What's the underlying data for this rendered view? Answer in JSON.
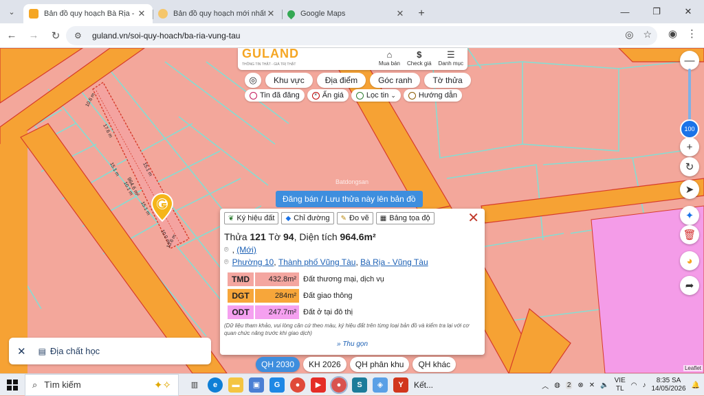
{
  "browser": {
    "tabs": [
      {
        "title": "Bản đồ quy hoạch Bà Rịa - Vũng",
        "active": true,
        "favicon_color": "#f5a623"
      },
      {
        "title": "Bản đồ quy hoạch mới nhất Th",
        "active": false,
        "favicon_color": "#f5a623"
      },
      {
        "title": "Google Maps",
        "active": false,
        "favicon_color": "#34a853"
      }
    ],
    "url": "guland.vn/soi-quy-hoach/ba-ria-vung-tau"
  },
  "header": {
    "logo": "GULAND",
    "tagline": "THÔNG TIN THẬT - GIÁ TRỊ THẬT",
    "nav": [
      {
        "label": "Mua bán",
        "icon": "house-icon"
      },
      {
        "label": "Check giá",
        "icon": "dollar-icon"
      },
      {
        "label": "Danh mục",
        "icon": "menu-icon"
      }
    ]
  },
  "chips": {
    "row1": [
      "Khu vực",
      "Địa điểm",
      "Góc ranh",
      "Tờ thửa"
    ],
    "row2": [
      "Tin đã đăng",
      "Ẩn giá",
      "Lọc tin",
      "Hướng dẫn"
    ]
  },
  "zoom": {
    "value": "100"
  },
  "share_button": "Đăng bán / Lưu thửa này lên bản đồ",
  "popup": {
    "tools": [
      "Ký hiệu đất",
      "Chỉ đường",
      "Đo vẽ",
      "Bảng tọa độ"
    ],
    "title_prefix": "Thửa",
    "parcel": "121",
    "sheet_label": "Tờ",
    "sheet": "94",
    "area_label": ", Diện tích",
    "area": "964.6m²",
    "address_new_prefix": ",",
    "address_new": "(Mới)",
    "ward": "Phường 10",
    "city": "Thành phố Vũng Tàu",
    "province": "Bà Rịa - Vũng Tàu",
    "land_use": [
      {
        "code": "TMD",
        "area": "432.8m²",
        "desc": "Đất thương mại, dịch vụ",
        "color": "#f4a6a0"
      },
      {
        "code": "DGT",
        "area": "284m²",
        "desc": "Đất giao thông",
        "color": "#f7a63a"
      },
      {
        "code": "ODT",
        "area": "247.7m²",
        "desc": "Đất ở tại đô thị",
        "color": "#f5a0f0"
      }
    ],
    "note": "(Dữ liệu tham khảo, vui lòng căn cứ theo màu, ký hiệu đất trên từng loại bản đồ và kiểm tra lại với cơ quan chức năng trước khi giao dịch)",
    "collapse": "Thu gọn"
  },
  "geology_panel": {
    "label": "Địa chất học"
  },
  "plan_tabs": [
    "QH 2030",
    "KH 2026",
    "QH phân khu",
    "QH khác"
  ],
  "attribution": "Leaflet",
  "map_labels": {
    "d1": "10.6 m",
    "d2": "17.6 m",
    "d3": "15.1 m",
    "d4": "15.1 m",
    "d5": "10.1 m",
    "d6": "15.1 m",
    "d7": "10.0 m",
    "d8": "10.6 m",
    "area": "964.6 m²",
    "watermark": "Batdongsan"
  },
  "taskbar": {
    "search": "Tìm kiếm",
    "running_app": "Kết...",
    "lang1": "VIE",
    "lang2": "TL",
    "time": "8:35 SA",
    "date": "14/05/2026",
    "badge": "2"
  }
}
